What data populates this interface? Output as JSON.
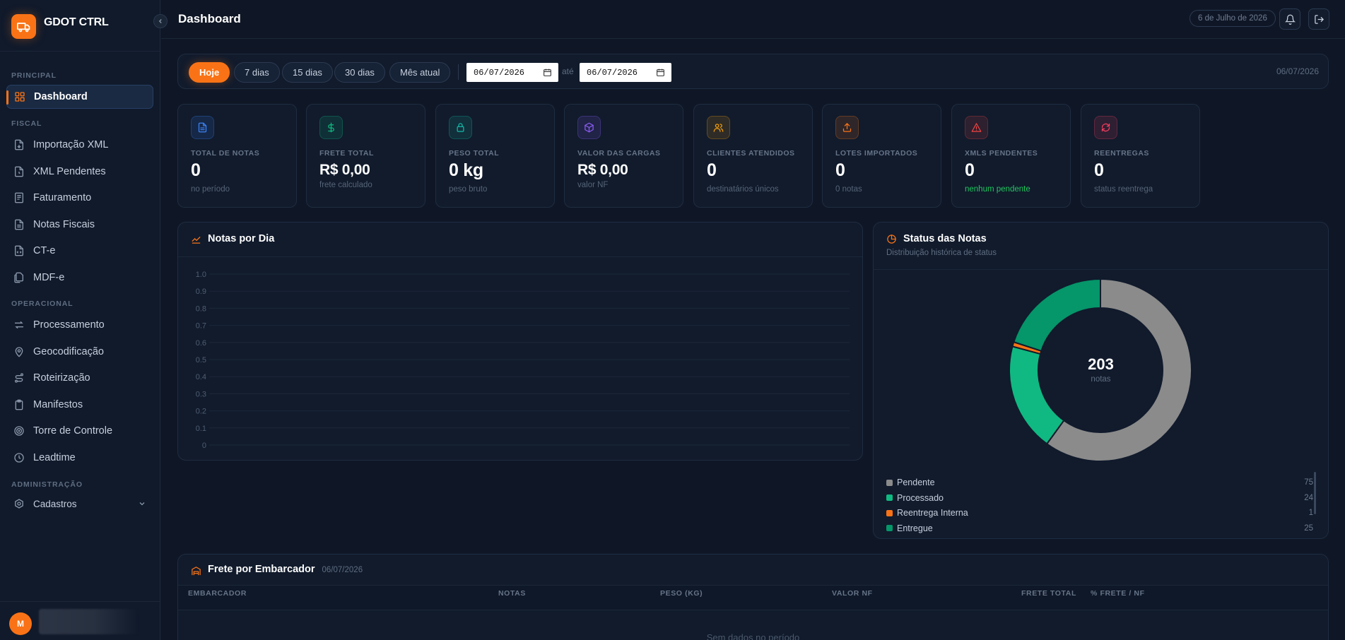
{
  "brand": {
    "name": "GDOT CTRL"
  },
  "sidebar": {
    "sections": {
      "principal": "PRINCIPAL",
      "fiscal": "FISCAL",
      "operacional": "OPERACIONAL",
      "administracao": "ADMINISTRAÇÃO"
    },
    "items": {
      "dashboard": "Dashboard",
      "importacao_xml": "Importação XML",
      "xml_pendentes": "XML Pendentes",
      "faturamento": "Faturamento",
      "notas_fiscais": "Notas Fiscais",
      "cte": "CT-e",
      "mdfe": "MDF-e",
      "processamento": "Processamento",
      "geocodificacao": "Geocodificação",
      "roteirizacao": "Roteirização",
      "manifestos": "Manifestos",
      "torre_controle": "Torre de Controle",
      "leadtime": "Leadtime",
      "cadastros": "Cadastros"
    },
    "user_initial": "M"
  },
  "header": {
    "title": "Dashboard",
    "date": "6 de Julho de 2026"
  },
  "filters": {
    "chips": [
      "Hoje",
      "7 dias",
      "15 dias",
      "30 dias",
      "Mês atual"
    ],
    "date_from": "06/07/2026",
    "separator": "até",
    "date_to": "06/07/2026",
    "current": "06/07/2026"
  },
  "stats": [
    {
      "label": "TOTAL DE NOTAS",
      "value": "0",
      "sub": "no período",
      "color": "#3b82f6"
    },
    {
      "label": "FRETE TOTAL",
      "value": "R$ 0,00",
      "sub": "frete calculado",
      "color": "#10b981"
    },
    {
      "label": "PESO TOTAL",
      "value": "0 kg",
      "sub": "peso bruto",
      "color": "#14b8a6"
    },
    {
      "label": "VALOR DAS CARGAS",
      "value": "R$ 0,00",
      "sub": "valor NF",
      "color": "#8b5cf6"
    },
    {
      "label": "CLIENTES ATENDIDOS",
      "value": "0",
      "sub": "destinatários únicos",
      "color": "#f59e0b"
    },
    {
      "label": "LOTES IMPORTADOS",
      "value": "0",
      "sub": "0 notas",
      "color": "#f97316"
    },
    {
      "label": "XMLS PENDENTES",
      "value": "0",
      "sub": "nenhum pendente",
      "color": "#ef4444"
    },
    {
      "label": "REENTREGAS",
      "value": "0",
      "sub": "status reentrega",
      "color": "#f43f5e"
    }
  ],
  "notas_por_dia": {
    "title": "Notas por Dia",
    "y_ticks": [
      "1.0",
      "0.9",
      "0.8",
      "0.7",
      "0.6",
      "0.5",
      "0.4",
      "0.3",
      "0.2",
      "0.1",
      "0"
    ]
  },
  "status": {
    "title": "Status das Notas",
    "subtitle": "Distribuição histórica de status",
    "total": "203",
    "total_label": "notas"
  },
  "chart_data": {
    "type": "pie",
    "variant": "donut",
    "categories": [
      "Pendente",
      "Processado",
      "Reentrega Interna",
      "Entregue"
    ],
    "values": [
      75,
      24,
      1,
      25
    ],
    "colors": [
      "#8b8b8b",
      "#10b981",
      "#f97316",
      "#059669"
    ],
    "center_value": 203
  },
  "frete": {
    "title": "Frete por Embarcador",
    "date": "06/07/2026",
    "columns": [
      "EMBARCADOR",
      "NOTAS",
      "PESO (KG)",
      "VALOR NF",
      "FRETE TOTAL",
      "% FRETE / NF"
    ],
    "empty": "Sem dados no período"
  }
}
